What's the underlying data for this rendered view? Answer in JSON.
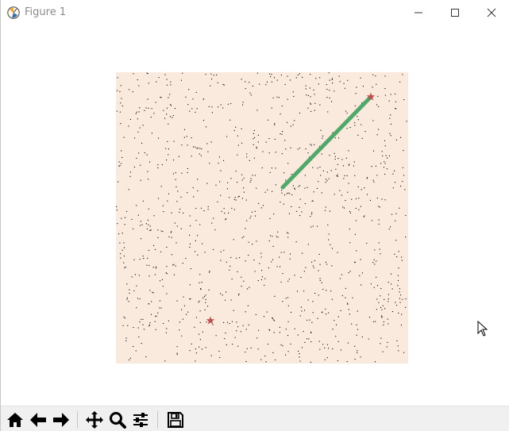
{
  "window": {
    "title": "Figure 1",
    "controls": {
      "minimize": "minimize-icon",
      "maximize": "maximize-icon",
      "close": "close-icon"
    }
  },
  "plot": {
    "background_color": "#f9eadd",
    "dot_color": "#000000",
    "path_color": "#52a86a",
    "marker_color": "#b8504f",
    "markers": "star",
    "axes_visible": false
  },
  "toolbar": {
    "buttons": [
      {
        "icon": "home-icon"
      },
      {
        "icon": "back-arrow-icon"
      },
      {
        "icon": "forward-arrow-icon"
      },
      {
        "icon": "pan-icon"
      },
      {
        "icon": "zoom-icon"
      },
      {
        "icon": "configure-subplots-icon"
      },
      {
        "icon": "save-icon"
      }
    ]
  }
}
